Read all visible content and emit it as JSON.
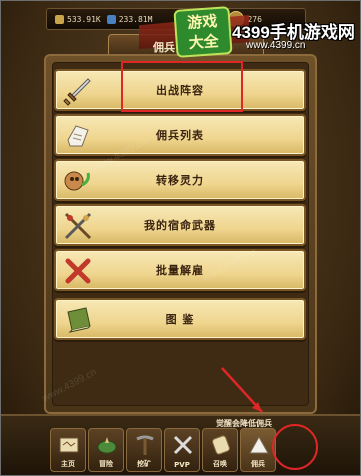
{
  "resources": [
    {
      "name": "coin",
      "value": "533.91K",
      "color": "#c9a44b"
    },
    {
      "name": "energy",
      "value": "233.81M",
      "color": "#4a7fc1"
    },
    {
      "name": "gem",
      "value": "276",
      "color": "#9a5fc9"
    }
  ],
  "header": {
    "title": "佣兵"
  },
  "watermark": {
    "logo_line1": "游戏",
    "logo_line2": "大全",
    "brand": "4399手机游戏网",
    "url": "www.4399.cn"
  },
  "menu": [
    {
      "label": "出战阵容",
      "icon": "sword-icon"
    },
    {
      "label": "佣兵列表",
      "icon": "scroll-icon"
    },
    {
      "label": "转移灵力",
      "icon": "spirit-transfer-icon"
    },
    {
      "label": "我的宿命武器",
      "icon": "crossed-weapons-icon"
    },
    {
      "label": "批量解雇",
      "icon": "red-x-icon"
    },
    {
      "label": "图 鉴",
      "icon": "book-icon"
    }
  ],
  "bottom": {
    "tip": "觉醒会降低佣兵",
    "nav": [
      {
        "label": "主页",
        "icon": "map-icon"
      },
      {
        "label": "冒险",
        "icon": "adventure-icon"
      },
      {
        "label": "挖矿",
        "icon": "pickaxe-icon"
      },
      {
        "label": "PVP",
        "icon": "swords-icon"
      },
      {
        "label": "召唤",
        "icon": "summon-scroll-icon"
      },
      {
        "label": "佣兵",
        "icon": "mercenary-tent-icon"
      }
    ]
  },
  "colors": {
    "highlight": "#e02626",
    "parchment": "#f3dfa0",
    "frame": "#3b2a16"
  }
}
